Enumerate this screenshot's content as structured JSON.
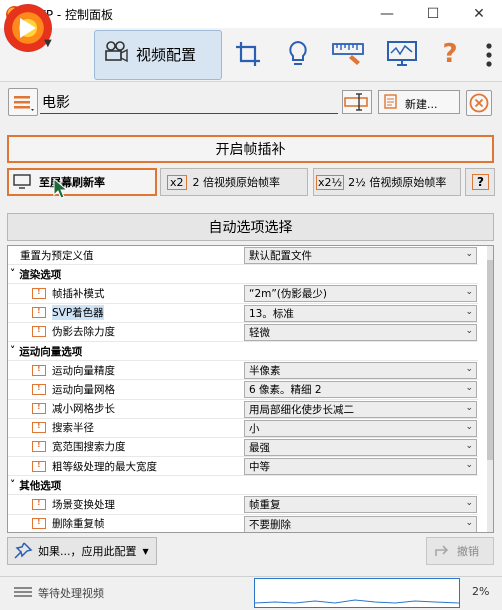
{
  "window": {
    "title": "SVP - 控制面板",
    "minimize_glyph": "—",
    "maximize_glyph": "☐",
    "close_glyph": "✕"
  },
  "header": {
    "active_tab_label": "视频配置",
    "icons": [
      "video-camera-icon",
      "crop-icon",
      "lightbulb-icon",
      "ruler-icon",
      "monitor-icon",
      "help-icon"
    ]
  },
  "profile": {
    "name": "电影",
    "new_label": "新建...",
    "close_glyph": "✕"
  },
  "enable_button": "开启帧插补",
  "rate_buttons": {
    "screen_label": "至屏幕刷新率",
    "x2_badge": "x2",
    "x2_label": "2 倍视频原始帧率",
    "x25_badge": "x2½",
    "x25_label": "2½ 倍视频原始帧率",
    "help_label": "?"
  },
  "auto_select": "自动选项选择",
  "settings": {
    "reset_row": {
      "label": "重置为预定义值",
      "value": "默认配置文件"
    },
    "sections": [
      {
        "title": "渲染选项",
        "rows": [
          {
            "label": "帧插补模式",
            "value": "“2m”(伪影最少)"
          },
          {
            "label": "SVP着色器",
            "value": "13。标准"
          },
          {
            "label": "伪影去除力度",
            "value": "轻微"
          }
        ]
      },
      {
        "title": "运动向量选项",
        "rows": [
          {
            "label": "运动向量精度",
            "value": "半像素"
          },
          {
            "label": "运动向量网格",
            "value": "6 像素。精细 2"
          },
          {
            "label": "减小网格步长",
            "value": "用局部细化使步长减二"
          },
          {
            "label": "搜索半径",
            "value": "小"
          },
          {
            "label": "宽范围搜索力度",
            "value": "最强"
          },
          {
            "label": "粗等级处理的最大宽度",
            "value": "中等"
          }
        ]
      },
      {
        "title": "其他选项",
        "rows": [
          {
            "label": "场景变换处理",
            "value": "帧重复"
          },
          {
            "label": "删除重复帧",
            "value": "不要删除"
          }
        ]
      }
    ]
  },
  "bottom": {
    "hint_label": "如果...，应用此配置",
    "undo_label": "撤销"
  },
  "status": {
    "text": "等待处理视频",
    "percent": "2%"
  },
  "colors": {
    "accent_orange": "#e07634",
    "selected_blue": "#cfe3f7",
    "graph_blue": "#2a76c9"
  }
}
